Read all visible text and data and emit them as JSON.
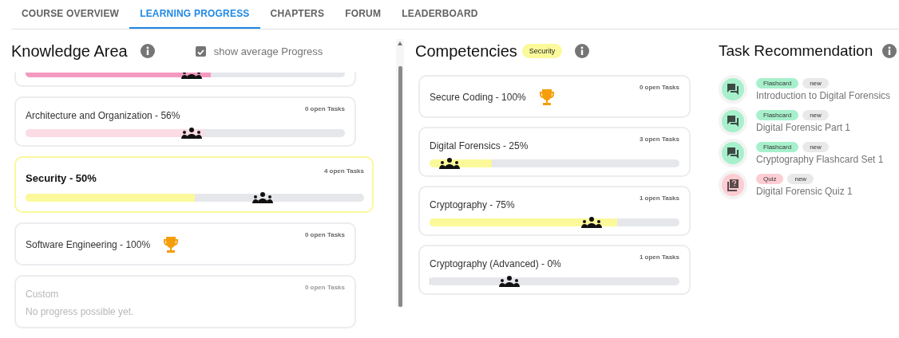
{
  "tabs": [
    {
      "label": "COURSE OVERVIEW",
      "selected": false
    },
    {
      "label": "LEARNING PROGRESS",
      "selected": true
    },
    {
      "label": "CHAPTERS",
      "selected": false
    },
    {
      "label": "FORUM",
      "selected": false
    },
    {
      "label": "LEADERBOARD",
      "selected": false
    }
  ],
  "knowledge_area": {
    "title": "Knowledge Area",
    "show_average": {
      "label": "show average Progress",
      "checked": true
    },
    "cards": [
      {
        "kind": "progress",
        "level": 0.58,
        "color": "#f49ac1",
        "average": {
          "level": 0.52
        },
        "selected": false
      },
      {
        "kind": "progress",
        "name": "Architecture and Organization - 56%",
        "open_tasks": "0 open Tasks",
        "level": 0.56,
        "color": "#fcdce4",
        "average": {
          "level": 0.52
        },
        "selected": false
      },
      {
        "kind": "progress",
        "name": "Security - 50%",
        "open_tasks": "4 open Tasks",
        "level": 0.5,
        "color": "#fbf99a",
        "average": {
          "level": 0.7
        },
        "selected": true
      },
      {
        "kind": "complete",
        "name": "Software Engineering - 100%",
        "open_tasks": "0 open Tasks",
        "selected": false
      },
      {
        "kind": "empty",
        "name": "Custom",
        "open_tasks": "0 open Tasks",
        "message": "No progress possible yet.",
        "selected": false
      }
    ]
  },
  "competencies": {
    "title": "Competencies",
    "filter": "Security",
    "cards": [
      {
        "kind": "complete",
        "name": "Secure Coding - 100%",
        "open_tasks": "0 open Tasks"
      },
      {
        "kind": "progress",
        "name": "Digital Forensics - 25%",
        "open_tasks": "3 open Tasks",
        "level": 0.25,
        "color": "#fbf99a",
        "average": {
          "level": 0.08
        }
      },
      {
        "kind": "progress",
        "name": "Cryptography - 75%",
        "open_tasks": "1 open Tasks",
        "level": 0.75,
        "color": "#fbf99a",
        "average": {
          "level": 0.65
        }
      },
      {
        "kind": "progress",
        "name": "Cryptography (Advanced) - 0%",
        "open_tasks": "1 open Tasks",
        "level": 0.0,
        "average": {
          "level": 0.32
        }
      }
    ]
  },
  "task_recommendation": {
    "title": "Task Recommendation",
    "items": [
      {
        "kind": "flashcard",
        "tag": "Flashcard",
        "color": "#a7f0cc",
        "status": "new",
        "title": "Introduction to Digital Forensics"
      },
      {
        "kind": "flashcard",
        "tag": "Flashcard",
        "color": "#a7f0cc",
        "status": "new",
        "title": "Digital Forensic Part 1"
      },
      {
        "kind": "flashcard",
        "tag": "Flashcard",
        "color": "#a7f0cc",
        "status": "new",
        "title": "Cryptography Flashcard Set 1"
      },
      {
        "kind": "quiz",
        "tag": "Quiz",
        "color": "#fccdd3",
        "status": "new",
        "title": "Digital Forensic Quiz 1"
      }
    ]
  }
}
